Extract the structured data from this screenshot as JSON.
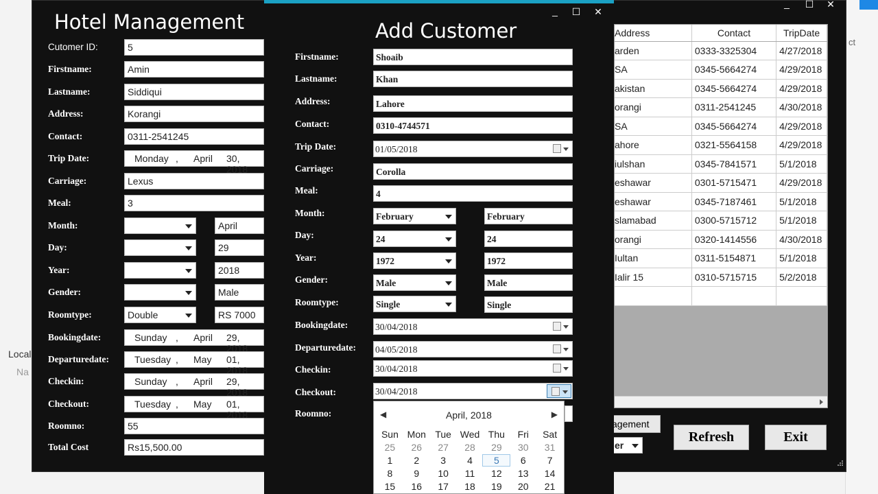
{
  "ide": {
    "left_label": "Local",
    "left_sub": "Na",
    "right_label": "ct"
  },
  "main": {
    "title": "Hotel Management",
    "fields": {
      "customer_id_label": "Cutomer ID:",
      "customer_id": "5",
      "firstname_label": "Firstname:",
      "firstname": "Amin",
      "lastname_label": "Lastname:",
      "lastname": "Siddiqui",
      "address_label": "Address:",
      "address": "Korangi",
      "contact_label": "Contact:",
      "contact": "0311-2541245",
      "tripdate_label": "Trip Date:",
      "tripdate": [
        "Monday",
        ",",
        "April",
        "30, 2018"
      ],
      "carriage_label": "Carriage:",
      "carriage": "Lexus",
      "meal_label": "Meal:",
      "meal": "3",
      "month_label": "Month:",
      "month_text": "April",
      "day_label": "Day:",
      "day_text": "29",
      "year_label": "Year:",
      "year_text": "2018",
      "gender_label": "Gender:",
      "gender_text": "Male",
      "roomtype_label": "Roomtype:",
      "roomtype_select": "Double",
      "roomtype_text": "RS 7000",
      "bookingdate_label": "Bookingdate:",
      "bookingdate": [
        "Sunday",
        ",",
        "April",
        "29, 2018"
      ],
      "departuredate_label": "Departuredate:",
      "departuredate": [
        "Tuesday",
        ",",
        "May",
        "01, 2018"
      ],
      "checkin_label": "Checkin:",
      "checkin": [
        "Sunday",
        ",",
        "April",
        "29, 2018"
      ],
      "checkout_label": "Checkout:",
      "checkout": [
        "Tuesday",
        ",",
        "May",
        "01, 2018"
      ],
      "roomno_label": "Roomno:",
      "roomno": "55",
      "totalcost_label": "Total Cost",
      "totalcost": "Rs15,500.00"
    },
    "grid": {
      "columns": [
        "Address",
        "Contact",
        "TripDate"
      ],
      "rows": [
        [
          "arden",
          "0333-3325304",
          "4/27/2018"
        ],
        [
          "SA",
          "0345-5664274",
          "4/29/2018"
        ],
        [
          "akistan",
          "0345-5664274",
          "4/29/2018"
        ],
        [
          "orangi",
          "0311-2541245",
          "4/30/2018"
        ],
        [
          "SA",
          "0345-5664274",
          "4/29/2018"
        ],
        [
          "ahore",
          "0321-5564158",
          "4/29/2018"
        ],
        [
          "iulshan",
          "0345-7841571",
          "5/1/2018"
        ],
        [
          "eshawar",
          "0301-5715471",
          "4/29/2018"
        ],
        [
          "eshawar",
          "0345-7187461",
          "5/1/2018"
        ],
        [
          "slamabad",
          "0300-5715712",
          "5/1/2018"
        ],
        [
          "orangi",
          "0320-1414556",
          "4/30/2018"
        ],
        [
          "Iultan",
          "0311-5154871",
          "5/1/2018"
        ],
        [
          "Ialir 15",
          "0310-5715715",
          "5/2/2018"
        ],
        [
          "",
          "",
          ""
        ]
      ]
    },
    "partial_button": "agement",
    "partial_select": "er",
    "refresh_label": "Refresh",
    "exit_label": "Exit"
  },
  "dialog": {
    "title": "Add Customer",
    "firstname_label": "Firstname:",
    "firstname": "Shoaib",
    "lastname_label": "Lastname:",
    "lastname": "Khan",
    "address_label": "Address:",
    "address": "Lahore",
    "contact_label": "Contact:",
    "contact": "0310-4744571",
    "tripdate_label": "Trip Date:",
    "tripdate": "01/05/2018",
    "carriage_label": "Carriage:",
    "carriage": "Corolla",
    "meal_label": "Meal:",
    "meal": "4",
    "month_label": "Month:",
    "month_select": "February",
    "month_text": "February",
    "day_label": "Day:",
    "day_select": "24",
    "day_text": "24",
    "year_label": "Year:",
    "year_select": "1972",
    "year_text": "1972",
    "gender_label": "Gender:",
    "gender_select": "Male",
    "gender_text": "Male",
    "roomtype_label": "Roomtype:",
    "roomtype_select": "Single",
    "roomtype_text": "Single",
    "bookingdate_label": "Bookingdate:",
    "bookingdate": "30/04/2018",
    "departuredate_label": "Departuredate:",
    "departuredate": "04/05/2018",
    "checkin_label": "Checkin:",
    "checkin": "30/04/2018",
    "checkout_label": "Checkout:",
    "checkout": "30/04/2018",
    "roomno_label": "Roomno:"
  },
  "calendar": {
    "header": "April, 2018",
    "prev": "◀",
    "next": "▶",
    "days_of_week": [
      "Sun",
      "Mon",
      "Tue",
      "Wed",
      "Thu",
      "Fri",
      "Sat"
    ],
    "weeks": [
      [
        "25",
        "26",
        "27",
        "28",
        "29",
        "30",
        "31"
      ],
      [
        "1",
        "2",
        "3",
        "4",
        "5",
        "6",
        "7"
      ],
      [
        "8",
        "9",
        "10",
        "11",
        "12",
        "13",
        "14"
      ],
      [
        "15",
        "16",
        "17",
        "18",
        "19",
        "20",
        "21"
      ]
    ],
    "selected_day": "5"
  }
}
